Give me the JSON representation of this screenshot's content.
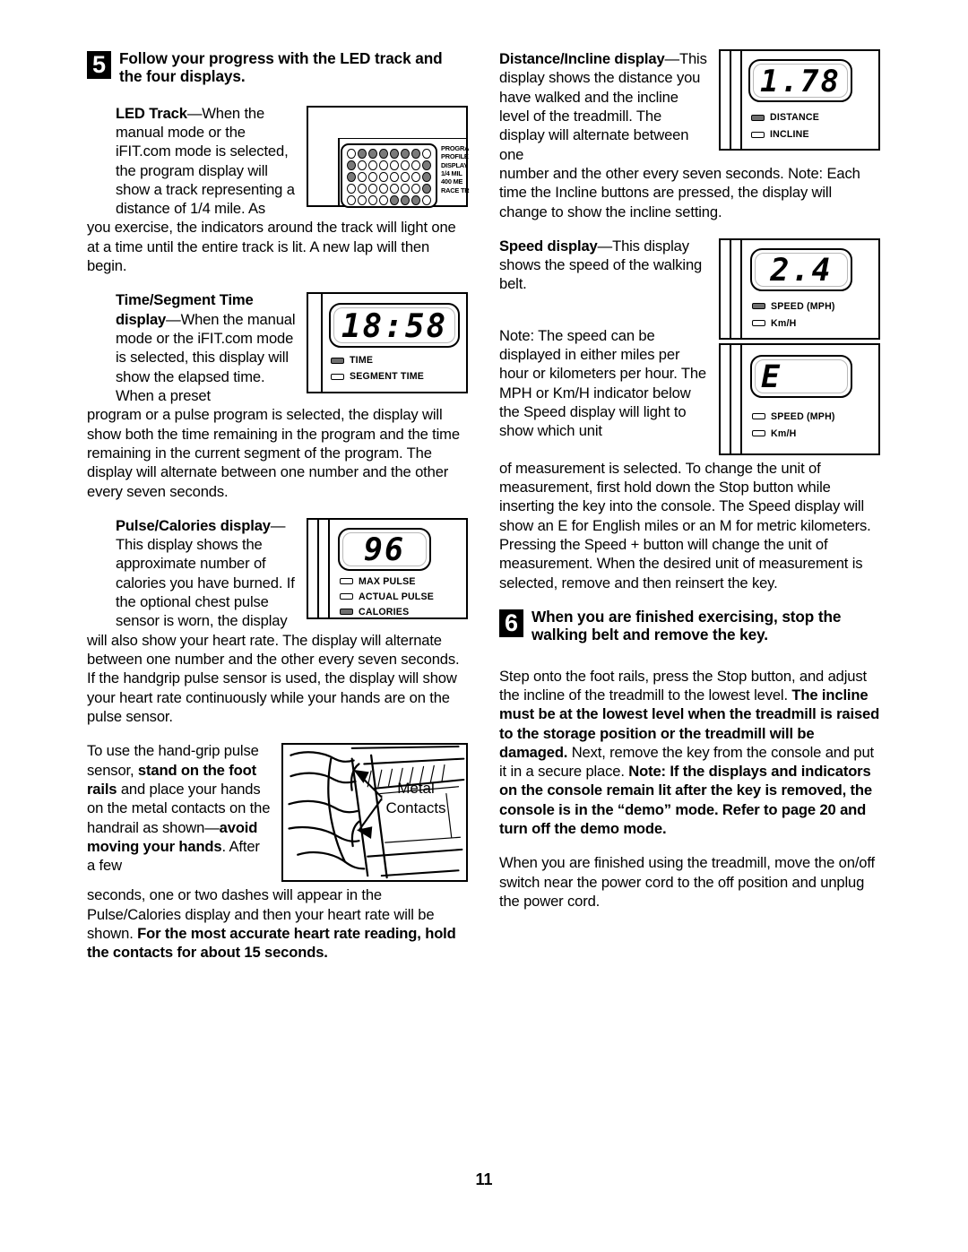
{
  "page": {
    "number": "11"
  },
  "steps": {
    "five": {
      "num": "5",
      "title": "Follow your progress with the LED track and the four displays."
    },
    "six": {
      "num": "6",
      "title": "When you are finished exercising, stop the walking belt and remove the key."
    }
  },
  "left_column": {
    "led_track": {
      "lead_bold": "LED Track",
      "lead_rest": "—When the manual mode or the iFIT.com mode is selected, the program display will show a track representing a distance of 1/4 mile. As",
      "continued": "you exercise, the indicators around the track will light one at a time until the entire track is lit. A new lap will then begin."
    },
    "time_segment": {
      "lead_bold": "Time/Segment Time display",
      "lead_rest": "—When the manual mode or the iFIT.com mode is selected, this display will show the elapsed time. When a preset",
      "continued": "program or a pulse program is selected, the display will show both the time remaining in the program and the time remaining in the current segment of the program. The display will alternate between one number and the other every seven seconds."
    },
    "pulse_calories": {
      "lead_bold": "Pulse/Calories display",
      "lead_rest": "—This display shows the approximate number of calories you have burned. If the optional chest pulse sensor is worn, the display",
      "continued": "will also show your heart rate. The display will alternate between one number and the other every seven seconds. If the handgrip pulse sensor is used, the display will show your heart rate continuously while your hands are on the pulse sensor."
    },
    "handgrip": {
      "part1": "To use the hand-grip pulse sensor, ",
      "bold1": "stand on the foot rails",
      "part2": " and place your hands on the metal contacts on the handrail as shown—",
      "bold2": "avoid moving your hands",
      "part3": ". After a few",
      "continued_part1": "seconds, one or two dashes will appear in the Pulse/Calories display and then your heart rate will be shown. ",
      "continued_bold": "For the most accurate heart rate reading, hold the contacts for about 15 seconds."
    }
  },
  "right_column": {
    "distance_incline": {
      "lead_bold": "Distance/Incline display",
      "lead_rest": "—This display shows the distance you have walked and the incline level of the treadmill. The display will alternate between one",
      "continued": "number and the other every seven seconds. Note: Each time the Incline buttons are pressed, the display will change to show the incline setting."
    },
    "speed": {
      "lead_bold": "Speed display",
      "lead_rest": "—This display shows the speed of the walking belt."
    },
    "speed_note": {
      "lead": "Note: The speed can be displayed in either miles per hour or kilometers per hour. The MPH or Km/H indicator below the Speed display will light to show which unit",
      "continued": "of measurement is selected. To change the unit of measurement, first hold down the Stop button while inserting the key into the console. The Speed display will show an E for English miles or an M for metric kilometers. Pressing the Speed + button will change the unit of measurement. When the desired unit of measurement is selected, remove and then reinsert the key."
    },
    "step6_body": {
      "part1": "Step onto the foot rails, press the Stop button, and adjust the incline of the treadmill to the lowest level. ",
      "bold1": "The incline must be at the lowest level when the treadmill is raised to the storage position or the treadmill will be damaged.",
      "part2": " Next, remove the key from the console and put it in a secure place. ",
      "bold2": "Note: If the displays and indicators on the console remain lit after the key is removed, the console is in the “demo” mode. Refer to page 20 and turn off the demo mode."
    },
    "closing": "When you are finished using the treadmill, move the on/off switch near the power cord to the off position and unplug the power cord."
  },
  "figures": {
    "led_track": {
      "caption_lines": [
        "PROGRA",
        "PROFILE",
        "DISPLAY",
        "1/4 MIL",
        "400 ME",
        "RACE TR"
      ],
      "grid": [
        [
          0,
          1,
          1,
          1,
          1,
          1,
          1,
          0
        ],
        [
          1,
          0,
          0,
          0,
          0,
          0,
          0,
          1
        ],
        [
          1,
          0,
          0,
          0,
          0,
          0,
          0,
          1
        ],
        [
          0,
          0,
          0,
          0,
          0,
          0,
          0,
          1
        ],
        [
          0,
          0,
          0,
          0,
          1,
          1,
          1,
          0
        ]
      ]
    },
    "time_display": {
      "value": "18:58",
      "indicators": [
        {
          "label": "TIME",
          "lit": true
        },
        {
          "label": "SEGMENT TIME",
          "lit": false
        }
      ]
    },
    "pulse_display": {
      "value": "96",
      "indicators": [
        {
          "label": "MAX PULSE",
          "lit": false
        },
        {
          "label": "ACTUAL PULSE",
          "lit": false
        },
        {
          "label": "CALORIES",
          "lit": true
        }
      ]
    },
    "distance_display": {
      "value": "1.78",
      "indicators": [
        {
          "label": "DISTANCE",
          "lit": true
        },
        {
          "label": "INCLINE",
          "lit": false
        }
      ]
    },
    "speed_display": {
      "value": "2.4",
      "indicators": [
        {
          "label": "SPEED  (MPH)",
          "lit": true
        },
        {
          "label": "Km/H",
          "lit": false
        }
      ]
    },
    "english_display": {
      "value": "E",
      "indicators": [
        {
          "label": "SPEED  (MPH)",
          "lit": false
        },
        {
          "label": "Km/H",
          "lit": false
        }
      ]
    },
    "handgrip_illustration": {
      "label_line1": "Metal",
      "label_line2": "Contacts"
    }
  }
}
